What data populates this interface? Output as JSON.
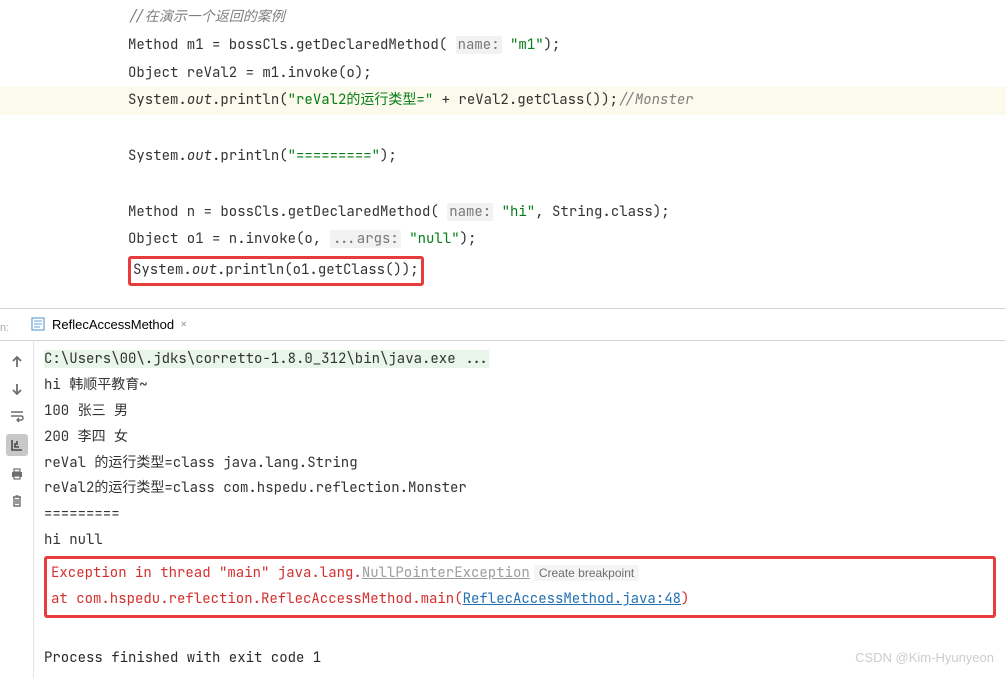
{
  "code": {
    "c1": "//在演示一个返回的案例",
    "l2a": "Method m1 = bossCls.getDeclaredMethod( ",
    "l2hint": "name:",
    "l2str": "\"m1\"",
    "l2b": ");",
    "l3": "Object reVal2 = m1.invoke(o);",
    "l4a": "System.",
    "l4b": ".println(",
    "l4str": "\"reVal2的运行类型=\"",
    "l4c": " + reVal2.getClass());",
    "l4comment": "//Monster",
    "l6a": "System.",
    "l6b": ".println(",
    "l6str": "\"=========\"",
    "l6c": ");",
    "l8a": "Method n = bossCls.getDeclaredMethod( ",
    "l8hint": "name:",
    "l8str": "\"hi\"",
    "l8b": ", String.class);",
    "l9a": "Object o1 = n.invoke(o, ",
    "l9hint": "...args:",
    "l9str": "\"null\"",
    "l9b": ");",
    "l10a": "System.",
    "l10b": ".println(o1.getClass());",
    "out": "out"
  },
  "tab": {
    "label": "ReflecAccessMethod"
  },
  "console": {
    "cmd": "C:\\Users\\00\\.jdks\\corretto-1.8.0_312\\bin\\java.exe ...",
    "o1": "hi 韩顺平教育~",
    "o2": "100 张三 男",
    "o3": "200 李四 女",
    "o4": "reVal 的运行类型=class java.lang.String",
    "o5": "reVal2的运行类型=class com.hspedu.reflection.Monster",
    "o6": "=========",
    "o7": "hi null",
    "err1a": "Exception in thread \"main\" java.lang.",
    "err1link": "NullPointerException",
    "err1bp": "Create breakpoint",
    "err2a": "\tat com.hspedu.reflection.ReflecAccessMethod.main(",
    "err2link": "ReflecAccessMethod.java:48",
    "err2b": ")",
    "exit": "Process finished with exit code 1"
  },
  "watermark": "CSDN @Kim-Hyunyeon"
}
